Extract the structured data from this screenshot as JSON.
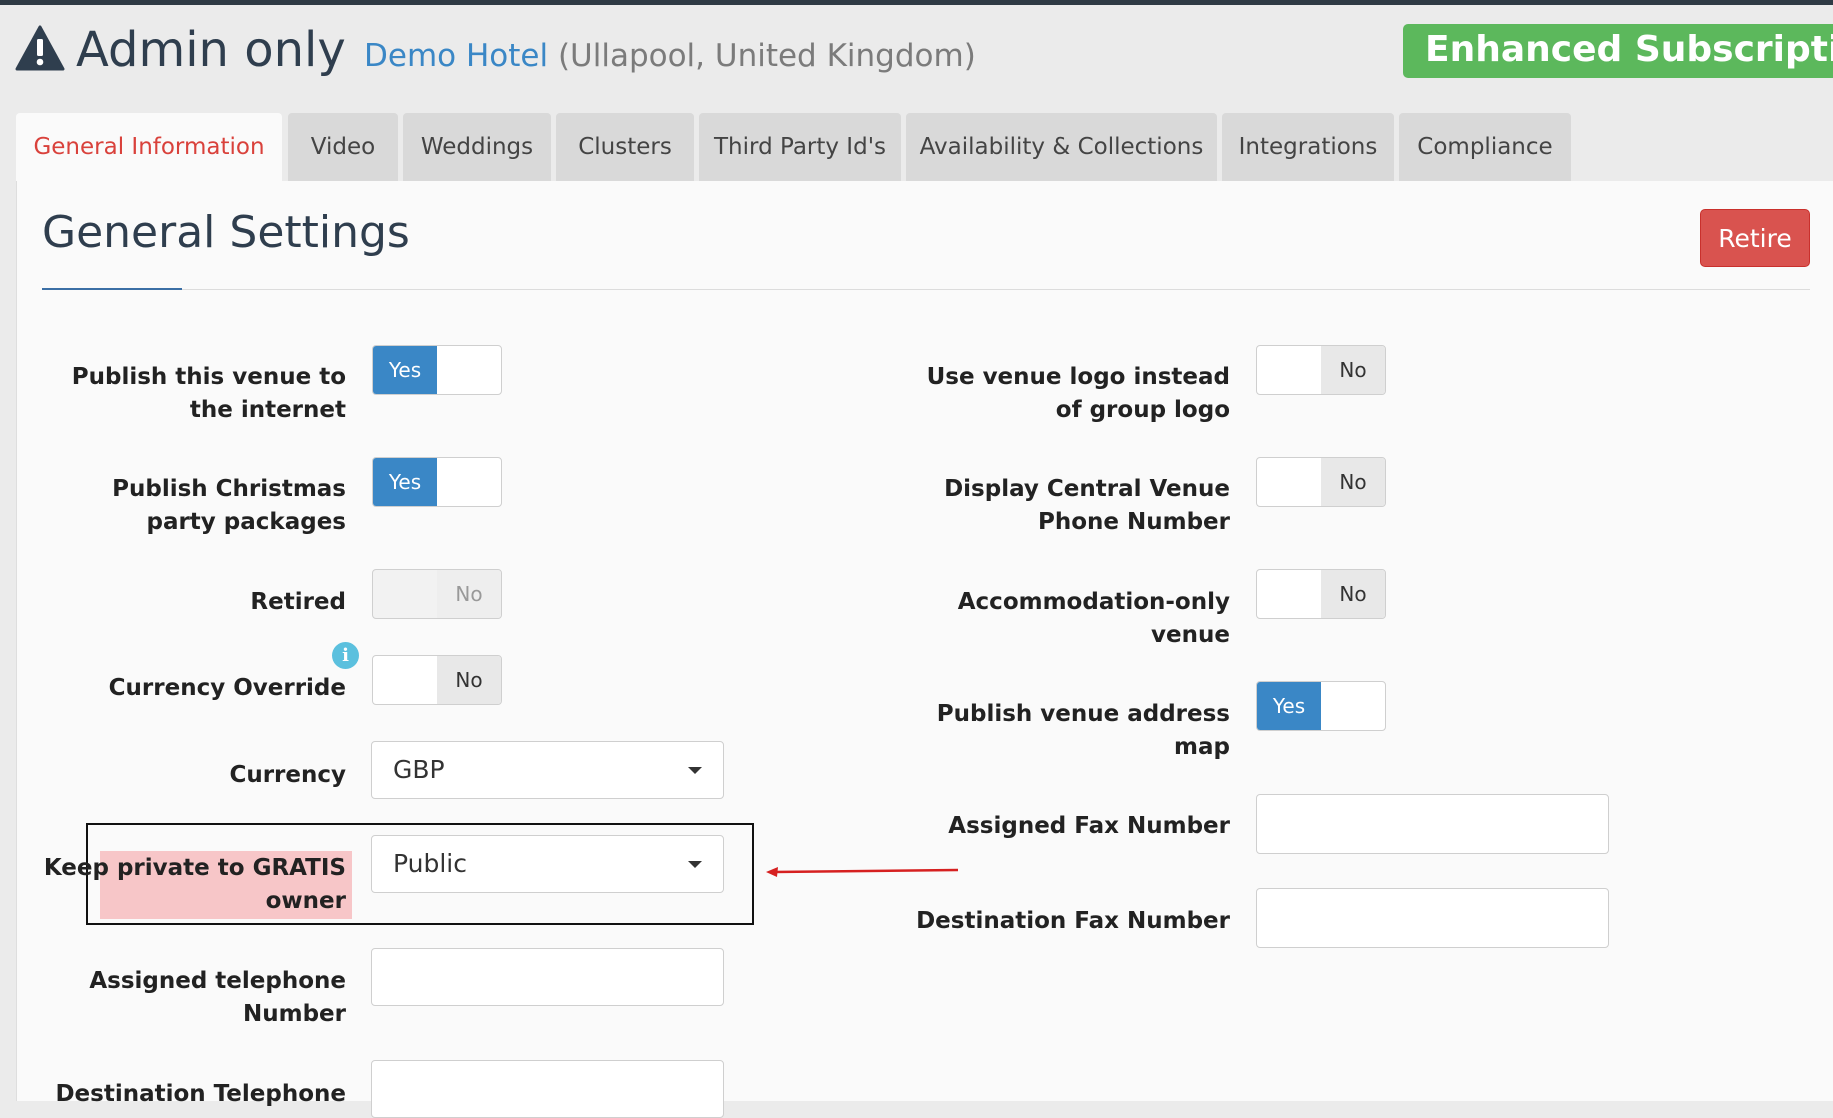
{
  "header": {
    "title": "Admin only",
    "venue_name": "Demo Hotel",
    "venue_location": "(Ullapool, United Kingdom)",
    "subscription": "Enhanced Subscription",
    "icon": "warning-triangle-icon"
  },
  "tabs": [
    {
      "label": "General Information",
      "active": true
    },
    {
      "label": "Video",
      "active": false
    },
    {
      "label": "Weddings",
      "active": false
    },
    {
      "label": "Clusters",
      "active": false
    },
    {
      "label": "Third Party Id's",
      "active": false
    },
    {
      "label": "Availability & Collections",
      "active": false
    },
    {
      "label": "Integrations",
      "active": false
    },
    {
      "label": "Compliance",
      "active": false
    }
  ],
  "section": {
    "title": "General Settings",
    "retire_label": "Retire"
  },
  "left_fields": {
    "publish_internet": {
      "label": "Publish this venue to the internet",
      "value": "Yes"
    },
    "publish_christmas": {
      "label": "Publish Christmas party packages",
      "value": "Yes"
    },
    "retired": {
      "label": "Retired",
      "value": "No"
    },
    "currency_override": {
      "label": "Currency Override",
      "value": "No"
    },
    "currency": {
      "label": "Currency",
      "value": "GBP"
    },
    "keep_private": {
      "label": "Keep private to GRATIS owner",
      "value": "Public"
    },
    "assigned_telephone": {
      "label": "Assigned telephone Number",
      "value": ""
    },
    "destination_telephone": {
      "label": "Destination Telephone",
      "value": ""
    }
  },
  "right_fields": {
    "use_venue_logo": {
      "label": "Use venue logo instead of group logo",
      "value": "No"
    },
    "display_central_phone": {
      "label": "Display Central Venue Phone Number",
      "value": "No"
    },
    "accommodation_only": {
      "label": "Accommodation-only venue",
      "value": "No"
    },
    "publish_address_map": {
      "label": "Publish venue address map",
      "value": "Yes"
    },
    "assigned_fax": {
      "label": "Assigned Fax Number",
      "value": ""
    },
    "destination_fax": {
      "label": "Destination Fax Number",
      "value": ""
    }
  },
  "colors": {
    "primary": "#3a87c6",
    "success": "#5cb85c",
    "danger": "#d9534f",
    "active_tab": "#d9413b",
    "annotation": "#d62020",
    "highlight": "#f7c6c8"
  }
}
